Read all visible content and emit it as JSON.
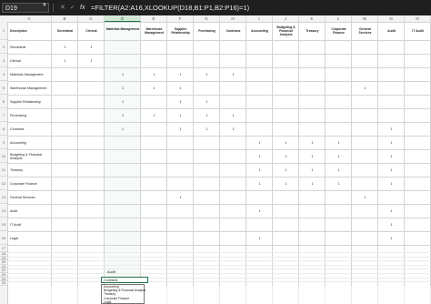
{
  "formula_bar": {
    "name_box": "D19",
    "cancel": "✕",
    "confirm": "✓",
    "fx": "fx",
    "formula": "=FILTER(A2:A16,XLOOKUP(D18,B1:P1,B2:P16)=1)"
  },
  "columns": [
    "A",
    "B",
    "C",
    "D",
    "E",
    "F",
    "G",
    "H",
    "I",
    "J",
    "K",
    "L",
    "M",
    "N",
    "O",
    "P"
  ],
  "selected_column": "D",
  "rows": [
    "1",
    "2",
    "3",
    "4",
    "5",
    "6",
    "7",
    "8",
    "9",
    "10",
    "11",
    "12",
    "13",
    "14",
    "15",
    "16",
    "17",
    "18",
    "19",
    "20",
    "21",
    "22",
    "23",
    "24",
    "25"
  ],
  "headers": [
    "Description",
    "Secretarial",
    "Clerical",
    "Materials Management",
    "Warehouse Management",
    "Supplier Relationship",
    "Purchasing",
    "Contracts",
    "Accounting",
    "Budgeting & Financial Analysis",
    "Treasury",
    "Corporate Finance",
    "General Services",
    "Audit",
    "IT Audit",
    "Legal"
  ],
  "descriptions": [
    "Secretarial",
    "Clerical",
    "Materials Management",
    "Warehouse Management",
    "Supplier Relationship",
    "Purchasing",
    "Contracts",
    "Accounting",
    "Budgeting & Financial Analysis",
    "Treasury",
    "Corporate Finance",
    "General Services",
    "Audit",
    "IT Audit",
    "Legal"
  ],
  "matrix": [
    [
      "1",
      "1",
      "",
      "",
      "",
      "",
      "",
      "",
      "",
      "",
      "",
      "",
      "",
      "",
      ""
    ],
    [
      "1",
      "1",
      "",
      "",
      "",
      "",
      "",
      "",
      "",
      "",
      "",
      "",
      "",
      "",
      ""
    ],
    [
      "",
      "",
      "1",
      "1",
      "1",
      "1",
      "1",
      "",
      "",
      "",
      "",
      "",
      "",
      "",
      ""
    ],
    [
      "",
      "",
      "1",
      "1",
      "1",
      "",
      "",
      "",
      "",
      "",
      "",
      "1",
      "",
      "",
      ""
    ],
    [
      "",
      "",
      "1",
      "",
      "1",
      "1",
      "",
      "",
      "",
      "",
      "",
      "",
      "",
      "",
      ""
    ],
    [
      "",
      "",
      "1",
      "1",
      "1",
      "1",
      "1",
      "",
      "",
      "",
      "",
      "",
      "",
      "",
      ""
    ],
    [
      "",
      "",
      "1",
      "",
      "1",
      "1",
      "1",
      "",
      "",
      "",
      "",
      "",
      "1",
      "",
      ""
    ],
    [
      "",
      "",
      "",
      "",
      "",
      "",
      "",
      "1",
      "1",
      "1",
      "1",
      "",
      "1",
      "",
      ""
    ],
    [
      "",
      "",
      "",
      "",
      "",
      "",
      "",
      "1",
      "1",
      "1",
      "1",
      "",
      "1",
      "",
      ""
    ],
    [
      "",
      "",
      "",
      "",
      "",
      "",
      "",
      "1",
      "1",
      "1",
      "1",
      "",
      "1",
      "",
      ""
    ],
    [
      "",
      "",
      "",
      "",
      "",
      "",
      "",
      "1",
      "1",
      "1",
      "1",
      "",
      "1",
      "",
      ""
    ],
    [
      "",
      "",
      "",
      "",
      "1",
      "",
      "",
      "",
      "",
      "",
      "",
      "1",
      "",
      "",
      ""
    ],
    [
      "",
      "",
      "",
      "",
      "",
      "",
      "",
      "1",
      "",
      "",
      "",
      "",
      "1",
      "",
      ""
    ],
    [
      "",
      "",
      "",
      "",
      "",
      "",
      "",
      "",
      "",
      "",
      "",
      "",
      "1",
      "",
      ""
    ],
    [
      "",
      "",
      "",
      "",
      "",
      "",
      "",
      "1",
      "",
      "",
      "",
      "",
      "1",
      "",
      "1"
    ]
  ],
  "audit_label": "Audit",
  "dropdown": {
    "value": "Contracts",
    "options": [
      "Accounting",
      "Budgeting & Financial Analysis",
      "Treasury",
      "Corporate Finance",
      "Legal"
    ]
  }
}
